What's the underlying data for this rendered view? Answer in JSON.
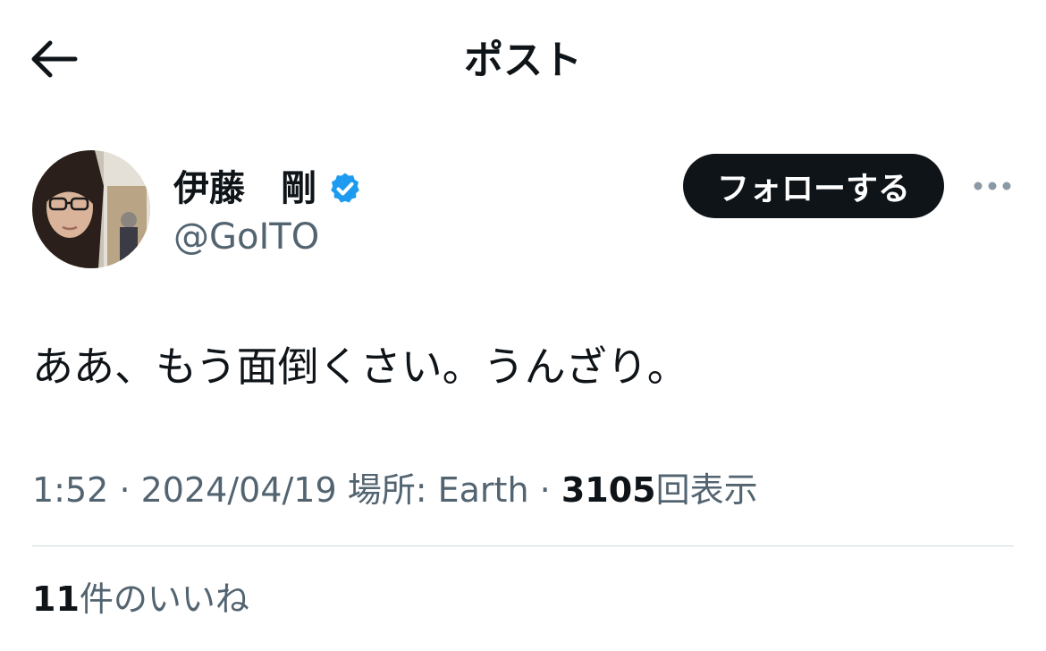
{
  "header": {
    "title": "ポスト",
    "back_icon": "arrow-left-icon"
  },
  "author": {
    "display_name": "伊藤　剛",
    "handle": "@GoITO",
    "verified_icon": "verified-badge-icon",
    "verified_color": "#1d9bf0",
    "follow_label": "フォローする",
    "more_icon": "more-horizontal-icon"
  },
  "post": {
    "text": "ああ、もう面倒くさい。うんざり。"
  },
  "meta": {
    "time": "1:52",
    "date": "2024/04/19",
    "location_label": "場所: Earth",
    "separator": "·",
    "views_count": "3105",
    "views_label": "回表示"
  },
  "likes": {
    "count": "11",
    "label": "件のいいね"
  },
  "colors": {
    "text_primary": "#0f1419",
    "text_secondary": "#536471",
    "divider": "#cfd9de",
    "accent": "#1d9bf0"
  }
}
